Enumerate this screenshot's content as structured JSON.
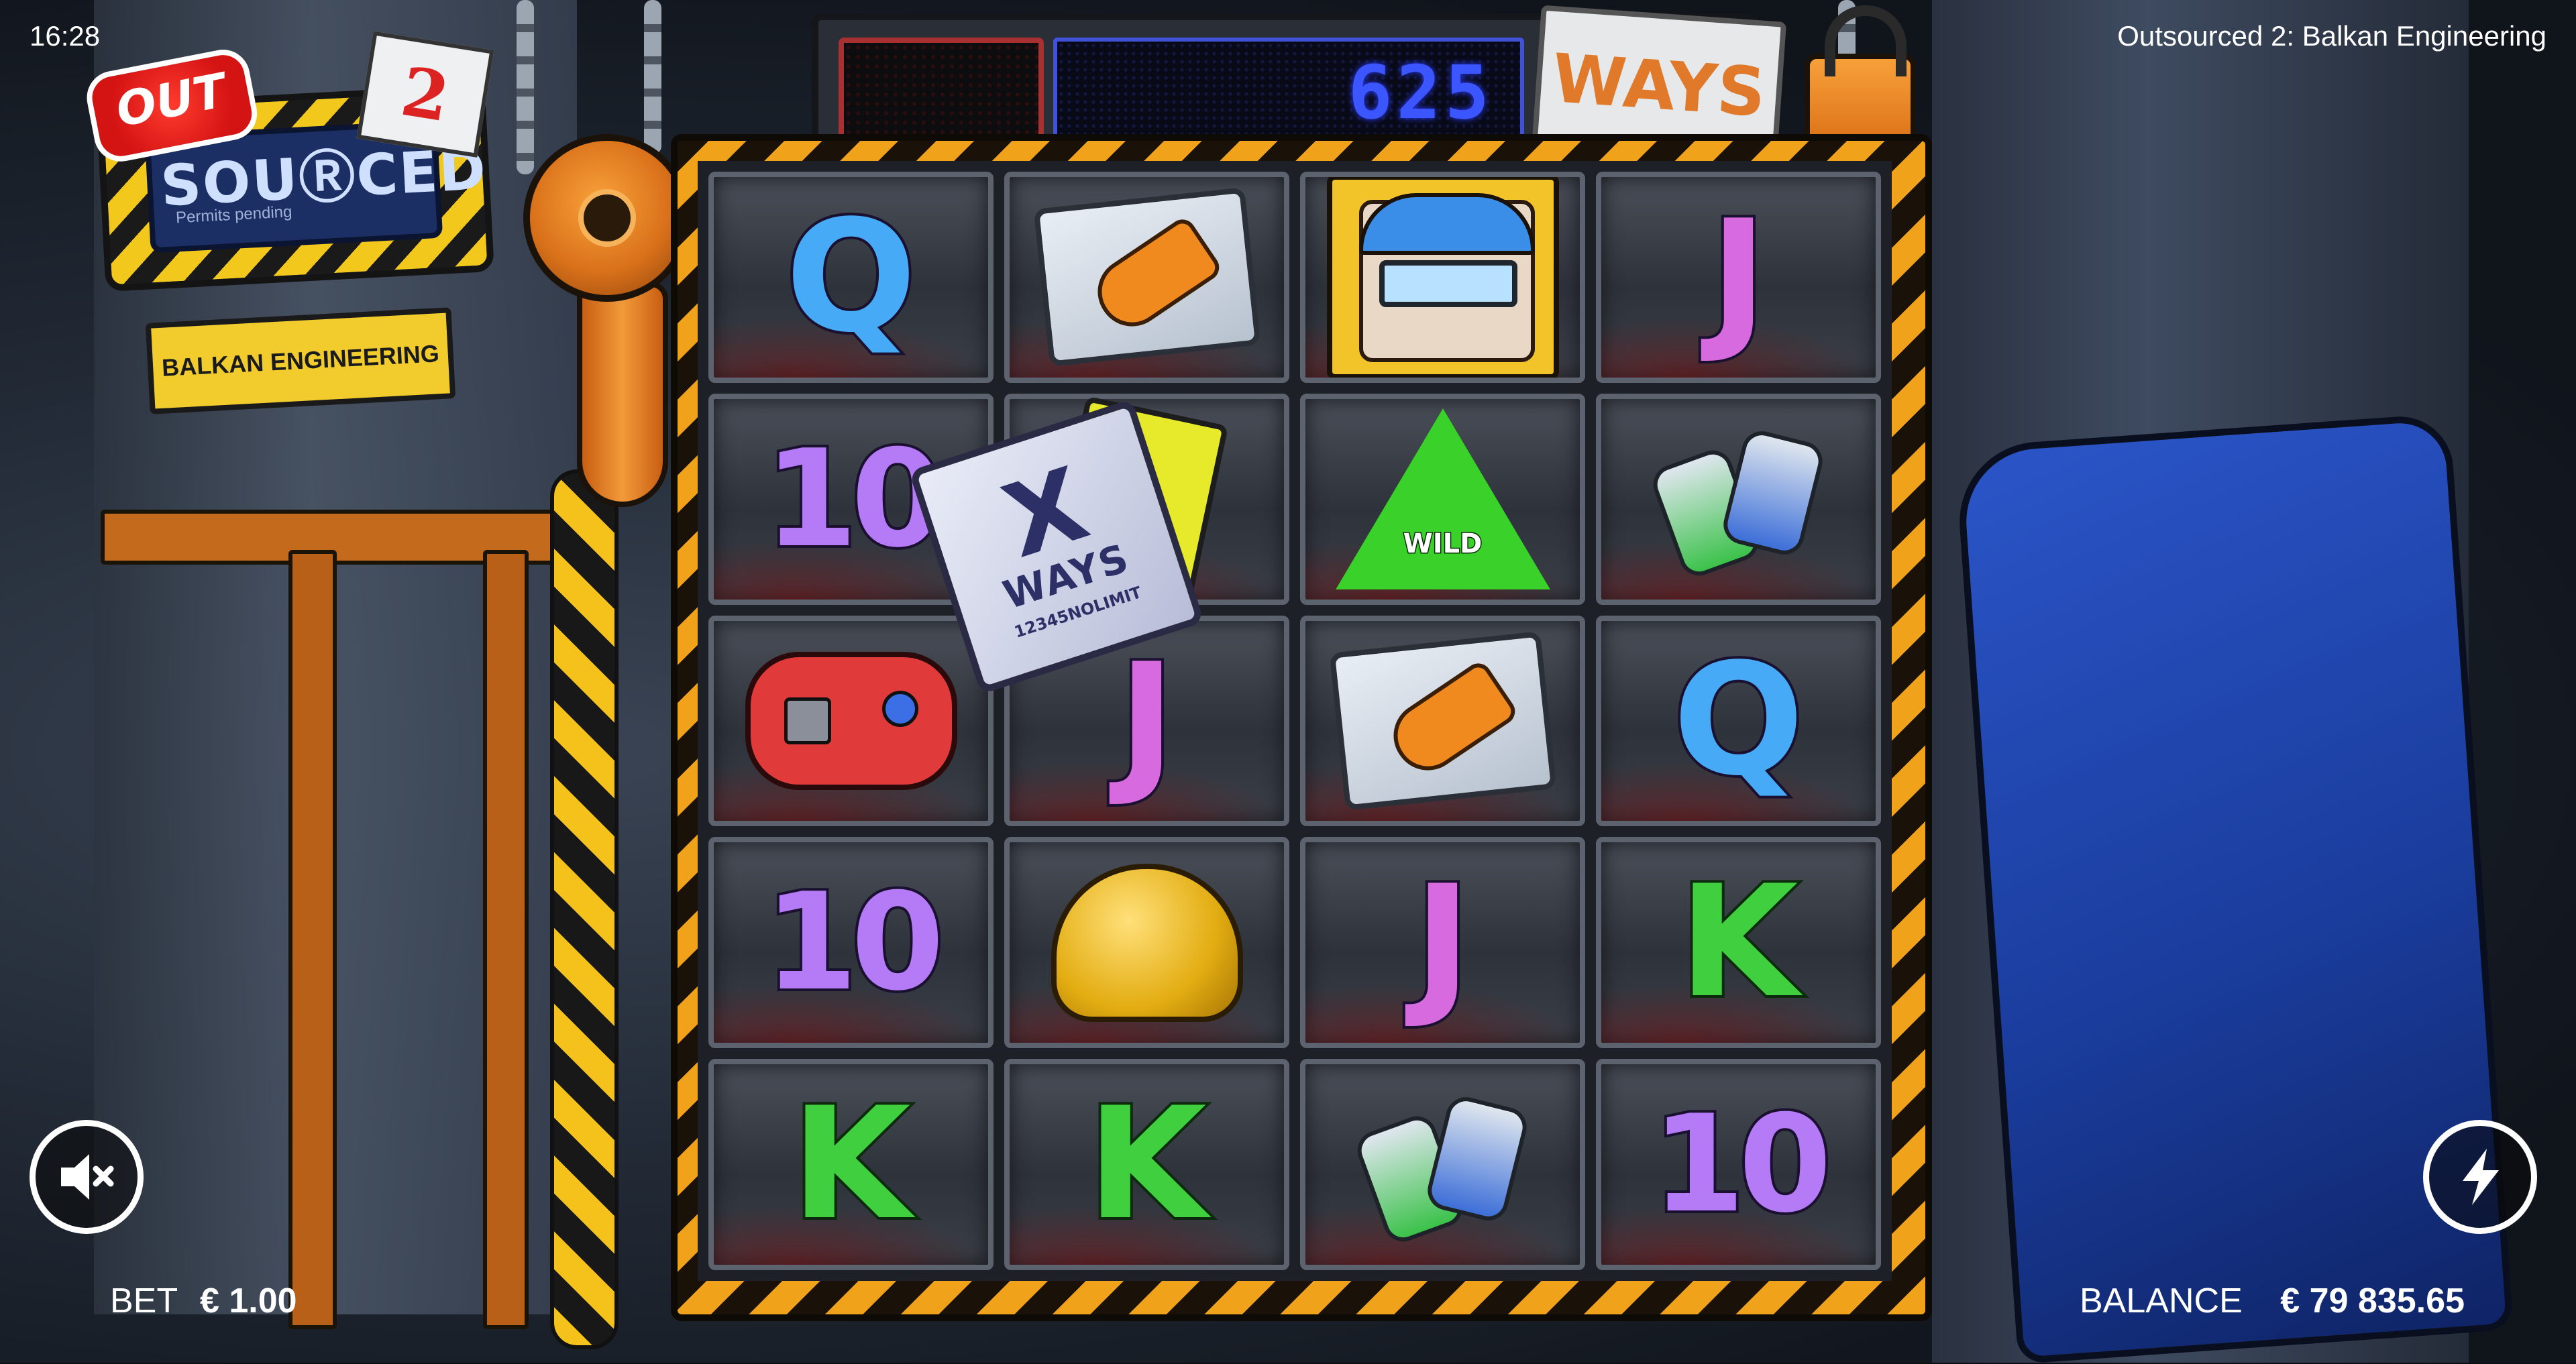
{
  "status": {
    "time": "16:28",
    "game_title": "Outsourced 2: Balkan Engineering"
  },
  "logo": {
    "out": "OUT",
    "sourced": "SOUⓇCED",
    "number": "2",
    "permits": "Permits pending",
    "sign": "BALKAN ENGINEERING"
  },
  "ways_meter": {
    "count": "625",
    "label": "WAYS"
  },
  "reels": [
    [
      {
        "symbol": "Q"
      },
      {
        "symbol": "hand-in-bag"
      },
      {
        "symbol": "foreman-portrait"
      },
      {
        "symbol": "J"
      }
    ],
    [
      {
        "symbol": "10"
      },
      {
        "symbol": "xways-card"
      },
      {
        "symbol": "wild-sign",
        "label": "WILD"
      },
      {
        "symbol": "crushed-cans"
      }
    ],
    [
      {
        "symbol": "gamepad"
      },
      {
        "symbol": "J"
      },
      {
        "symbol": "hand-in-bag"
      },
      {
        "symbol": "Q"
      }
    ],
    [
      {
        "symbol": "10"
      },
      {
        "symbol": "hard-hat"
      },
      {
        "symbol": "J"
      },
      {
        "symbol": "K"
      }
    ],
    [
      {
        "symbol": "K"
      },
      {
        "symbol": "K"
      },
      {
        "symbol": "crushed-cans"
      },
      {
        "symbol": "10"
      }
    ]
  ],
  "xways_card": {
    "x": "X",
    "label": "WAYS",
    "serial": "12345NOLIMIT"
  },
  "hud": {
    "bet_label": "BET",
    "bet_value": "€ 1.00",
    "balance_label": "BALANCE",
    "balance_value": "€ 79 835.65",
    "sound_icon": "speaker-muted-icon",
    "turbo_icon": "lightning-icon"
  }
}
